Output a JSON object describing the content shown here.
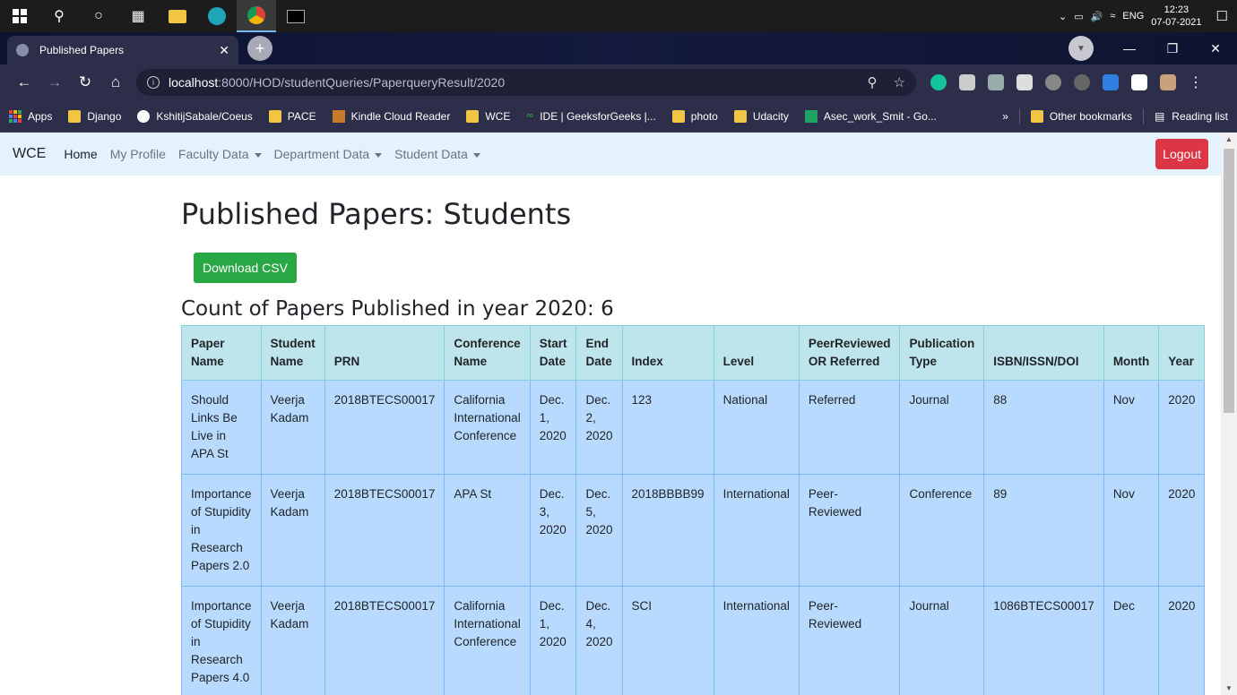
{
  "taskbar": {
    "time": "12:23",
    "date": "07-07-2021",
    "lang": "ENG"
  },
  "browser": {
    "tab_title": "Published Papers",
    "url_host": "localhost",
    "url_path": ":8000/HOD/studentQueries/PaperqueryResult/2020",
    "bookmarks": [
      "Apps",
      "Django",
      "KshitijSabale/Coeus",
      "PACE",
      "Kindle Cloud Reader",
      "WCE",
      "IDE | GeeksforGeeks |...",
      "photo",
      "Udacity",
      "Asec_work_Smit - Go..."
    ],
    "bookmarks_overflow": "»",
    "other_bookmarks": "Other bookmarks",
    "reading_list": "Reading list"
  },
  "navbar": {
    "brand": "WCE",
    "home": "Home",
    "profile": "My Profile",
    "faculty": "Faculty Data",
    "department": "Department Data",
    "student": "Student Data",
    "logout": "Logout"
  },
  "main": {
    "title": "Published Papers: Students",
    "download_label": "Download CSV",
    "count_heading": "Count of Papers Published in year 2020: 6"
  },
  "table": {
    "headers": [
      "Paper Name",
      "Student Name",
      "PRN",
      "Conference Name",
      "Start Date",
      "End Date",
      "Index",
      "Level",
      "PeerReviewed OR Referred",
      "Publication Type",
      "ISBN/ISSN/DOI",
      "Month",
      "Year"
    ],
    "rows": [
      [
        "Should Links Be Live in APA St",
        "Veerja Kadam",
        "2018BTECS00017",
        "California International Conference",
        "Dec. 1, 2020",
        "Dec. 2, 2020",
        "123",
        "National",
        "Referred",
        "Journal",
        "88",
        "Nov",
        "2020"
      ],
      [
        "Importance of Stupidity in Research Papers 2.0",
        "Veerja Kadam",
        "2018BTECS00017",
        "APA St",
        "Dec. 3, 2020",
        "Dec. 5, 2020",
        "2018BBBB99",
        "International",
        "Peer-Reviewed",
        "Conference",
        "89",
        "Nov",
        "2020"
      ],
      [
        "Importance of Stupidity in Research Papers 4.0",
        "Veerja Kadam",
        "2018BTECS00017",
        "California International Conference",
        "Dec. 1, 2020",
        "Dec. 4, 2020",
        "SCI",
        "International",
        "Peer-Reviewed",
        "Journal",
        "1086BTECS00017",
        "Dec",
        "2020"
      ]
    ]
  }
}
